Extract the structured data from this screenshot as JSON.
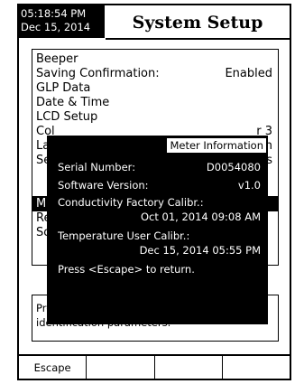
{
  "status": {
    "time": "05:18:54 PM",
    "date": "Dec 15, 2014"
  },
  "header": {
    "title": "System Setup"
  },
  "menu": {
    "items": [
      {
        "label": "Beeper",
        "value": ""
      },
      {
        "label": "Saving Confirmation:",
        "value": "Enabled"
      },
      {
        "label": "GLP Data",
        "value": ""
      },
      {
        "label": "Date & Time",
        "value": ""
      },
      {
        "label": "LCD Setup",
        "value": ""
      },
      {
        "label": "Col",
        "value": "r 3"
      },
      {
        "label": "Lar",
        "value": "ish"
      },
      {
        "label": "Ser",
        "value": "ops"
      },
      {
        "label": "Met",
        "value": ""
      },
      {
        "label": "Res",
        "value": ""
      },
      {
        "label": "Soft",
        "value": ""
      }
    ],
    "selected_index": 8
  },
  "info": {
    "line1": "Pre",
    "line2": "identification parameters."
  },
  "softkeys": [
    "Escape",
    "",
    "",
    ""
  ],
  "popup": {
    "title": "Meter Information",
    "serial_label": "Serial Number:",
    "serial_value": "D0054080",
    "software_label": "Software Version:",
    "software_value": "v1.0",
    "factory_label": "Conductivity Factory Calibr.:",
    "factory_value": "Oct 01, 2014 09:08 AM",
    "user_label": "Temperature User Calibr.:",
    "user_value": "Dec 15, 2014 05:55 PM",
    "hint": "Press <Escape> to return."
  }
}
